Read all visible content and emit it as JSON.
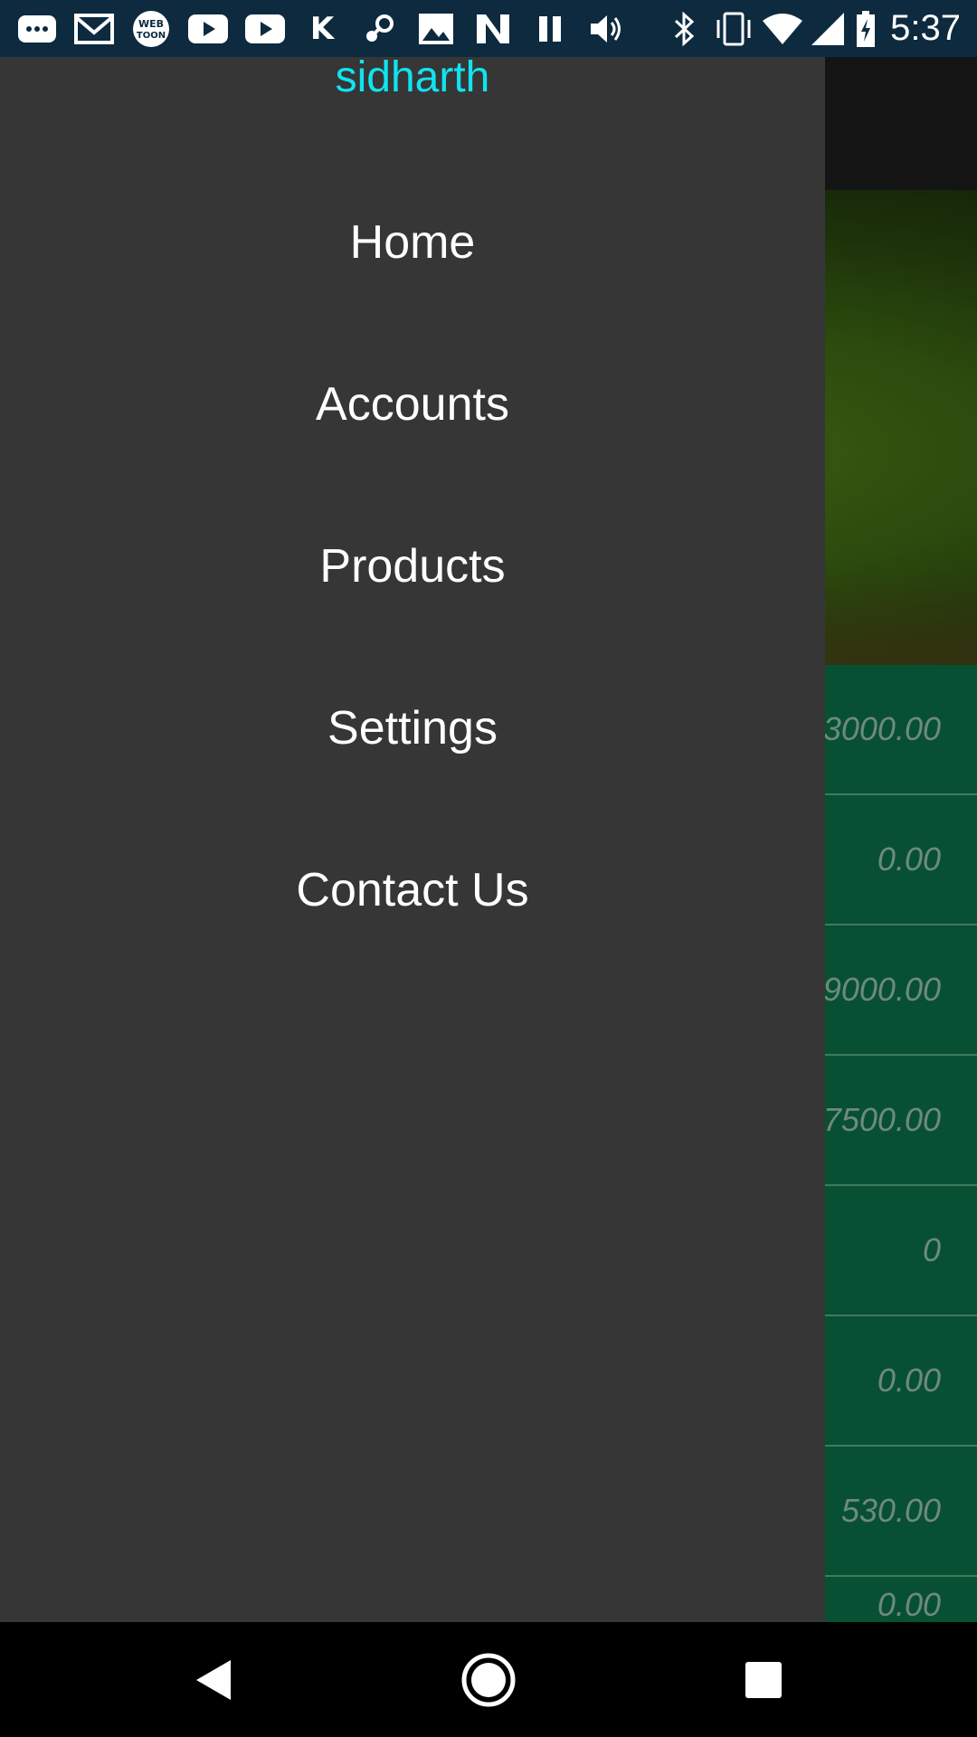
{
  "status_bar": {
    "time": "5:37",
    "left_icons": [
      "sms-icon",
      "gmail-icon",
      "webtoon-icon",
      "youtube-icon",
      "youtube-icon",
      "k-app-icon",
      "steam-icon",
      "gallery-icon",
      "n-app-icon",
      "pause-icon",
      "volume-icon"
    ],
    "right_icons": [
      "bluetooth-icon",
      "vibrate-icon",
      "wifi-icon",
      "cell-signal-icon",
      "battery-charging-icon"
    ],
    "background_color": "#0d2a3f"
  },
  "drawer": {
    "username": "sidharth",
    "username_color": "#11e3f0",
    "background_color": "#363636",
    "menu_items": [
      {
        "label": "Home"
      },
      {
        "label": "Accounts"
      },
      {
        "label": "Products"
      },
      {
        "label": "Settings"
      },
      {
        "label": "Contact Us"
      }
    ]
  },
  "background_app": {
    "hero_partial_text": ",",
    "list_color": "#075034",
    "rows": [
      {
        "value": "3000.00"
      },
      {
        "value": "0.00"
      },
      {
        "value": "9000.00"
      },
      {
        "value": "7500.00"
      },
      {
        "value": "0"
      },
      {
        "value": "0.00"
      },
      {
        "value": "530.00"
      },
      {
        "value": "0.00"
      }
    ]
  },
  "nav_bar": {
    "buttons": [
      "back-icon",
      "home-icon",
      "recents-icon"
    ]
  }
}
